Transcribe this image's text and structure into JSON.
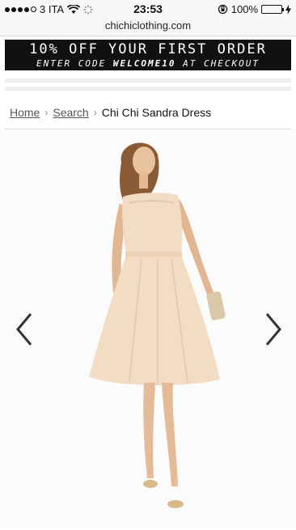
{
  "status": {
    "carrier": "3 ITA",
    "time": "23:53",
    "battery": "100%"
  },
  "url": "chichiclothing.com",
  "promo": {
    "line1": "10% OFF YOUR FIRST ORDER",
    "line2_prefix": "ENTER CODE",
    "code": "WELCOME10",
    "line2_suffix": "AT CHECKOUT"
  },
  "breadcrumb": {
    "home": "Home",
    "search": "Search",
    "current": "Chi Chi Sandra Dress"
  },
  "icons": {
    "prev": "chevron-left-icon",
    "next": "chevron-right-icon",
    "wifi": "wifi-icon",
    "lock": "orientation-lock-icon"
  }
}
